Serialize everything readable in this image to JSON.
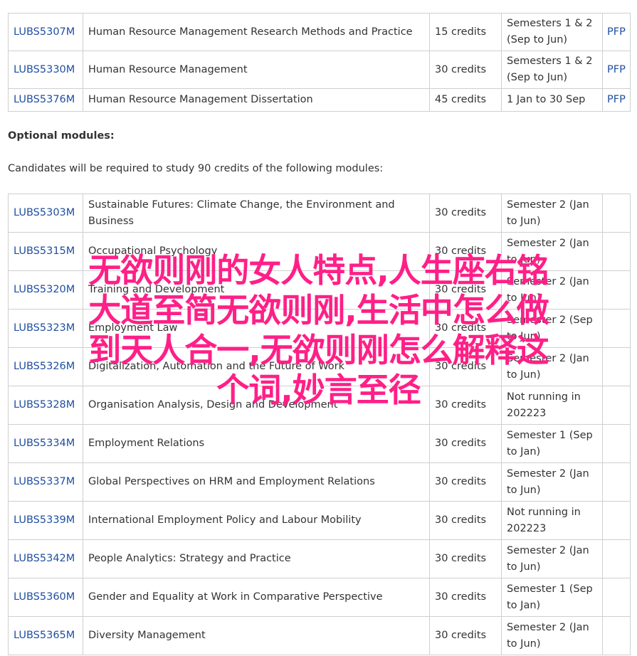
{
  "core_modules": [
    {
      "code": "LUBS5307M",
      "title": "Human Resource Management Research Methods and Practice",
      "credits": "15 credits",
      "semester": "Semesters 1 & 2 (Sep to Jun)",
      "pfp": "PFP"
    },
    {
      "code": "LUBS5330M",
      "title": "Human Resource Management",
      "credits": "30 credits",
      "semester": "Semesters 1 & 2 (Sep to Jun)",
      "pfp": "PFP"
    },
    {
      "code": "LUBS5376M",
      "title": "Human Resource Management Dissertation",
      "credits": "45 credits",
      "semester": "1 Jan to 30 Sep",
      "pfp": "PFP"
    }
  ],
  "optional_heading": "Optional modules:",
  "optional_intro": "Candidates will be required to study 90 credits of the following modules:",
  "optional_modules": [
    {
      "code": "LUBS5303M",
      "title": "Sustainable Futures: Climate Change, the Environment and Business",
      "credits": "30 credits",
      "semester": "Semester 2 (Jan to Jun)"
    },
    {
      "code": "LUBS5315M",
      "title": "Occupational Psychology",
      "credits": "30 credits",
      "semester": "Semester 2 (Jan to Jun)"
    },
    {
      "code": "LUBS5320M",
      "title": "Training and Development",
      "credits": "30 credits",
      "semester": "Semester 2 (Jan to Jun)"
    },
    {
      "code": "LUBS5323M",
      "title": "Employment Law",
      "credits": "30 credits",
      "semester": "Semester 2 (Sep to Jun)"
    },
    {
      "code": "LUBS5326M",
      "title": "Digitalization, Automation and the Future of Work",
      "credits": "30 credits",
      "semester": "Semester 2 (Jan to Jun)"
    },
    {
      "code": "LUBS5328M",
      "title": "Organisation Analysis, Design and Development",
      "credits": "30 credits",
      "semester": "Not running in 202223"
    },
    {
      "code": "LUBS5334M",
      "title": "Employment Relations",
      "credits": "30 credits",
      "semester": "Semester 1 (Sep to Jan)"
    },
    {
      "code": "LUBS5337M",
      "title": "Global Perspectives on HRM and Employment Relations",
      "credits": "30 credits",
      "semester": "Semester 2 (Jan to Jun)"
    },
    {
      "code": "LUBS5339M",
      "title": "International Employment Policy and Labour Mobility",
      "credits": "30 credits",
      "semester": "Not running in 202223"
    },
    {
      "code": "LUBS5342M",
      "title": "People Analytics: Strategy and Practice",
      "credits": "30 credits",
      "semester": "Semester 2 (Jan to Jun)"
    },
    {
      "code": "LUBS5360M",
      "title": "Gender and Equality at Work in Comparative Perspective",
      "credits": "30 credits",
      "semester": "Semester 1 (Sep to Jan)"
    },
    {
      "code": "LUBS5365M",
      "title": "Diversity Management",
      "credits": "30 credits",
      "semester": "Semester 2 (Jan to Jun)"
    }
  ],
  "watermark": {
    "line1": "无欲则刚的女人特点,人生座右铭",
    "line2": "大道至简无欲则刚,生活中怎么做",
    "line3": "到天人合一,无欲则刚怎么解释这",
    "line4": "个词,妙言至径"
  },
  "colors": {
    "link": "#1f4fa0",
    "border": "#cfcfcf",
    "text": "#333333",
    "watermark": "#ff1f87"
  }
}
